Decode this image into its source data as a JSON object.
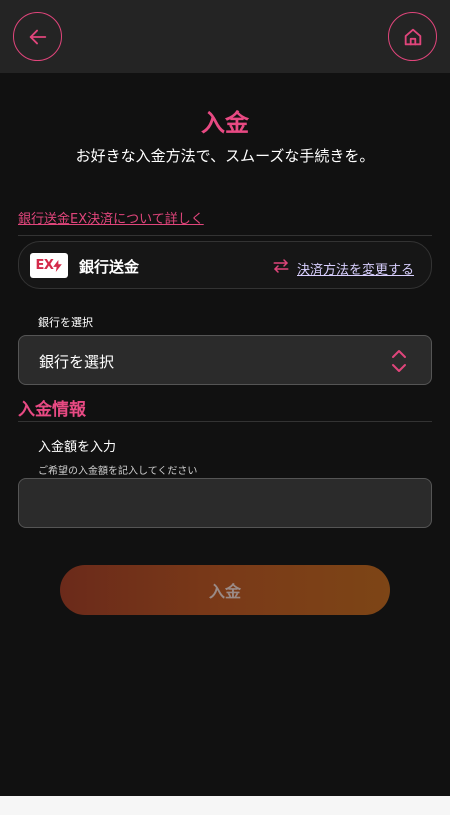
{
  "header": {
    "back_icon": "arrow-left-icon",
    "home_icon": "home-icon",
    "accent_color": "#e0457b"
  },
  "page": {
    "title": "入金",
    "subtitle": "お好きな入金方法で、スムーズな手続きを。"
  },
  "info_link": "銀行送金EX決済について詳しく",
  "method": {
    "logo_text": "EX",
    "logo_icon": "ex-payment-logo",
    "name": "銀行送金",
    "change_icon": "swap-arrows-icon",
    "change_label": "決済方法を変更する"
  },
  "bank": {
    "label": "銀行を選択",
    "select_value": "銀行を選択",
    "select_icon": "chevron-updown-icon"
  },
  "deposit_info": {
    "section_title": "入金情報",
    "amount_label": "入金額を入力",
    "amount_hint": "ご希望の入金額を記入してください",
    "amount_value": "",
    "amount_placeholder": ""
  },
  "submit_label": "入金"
}
